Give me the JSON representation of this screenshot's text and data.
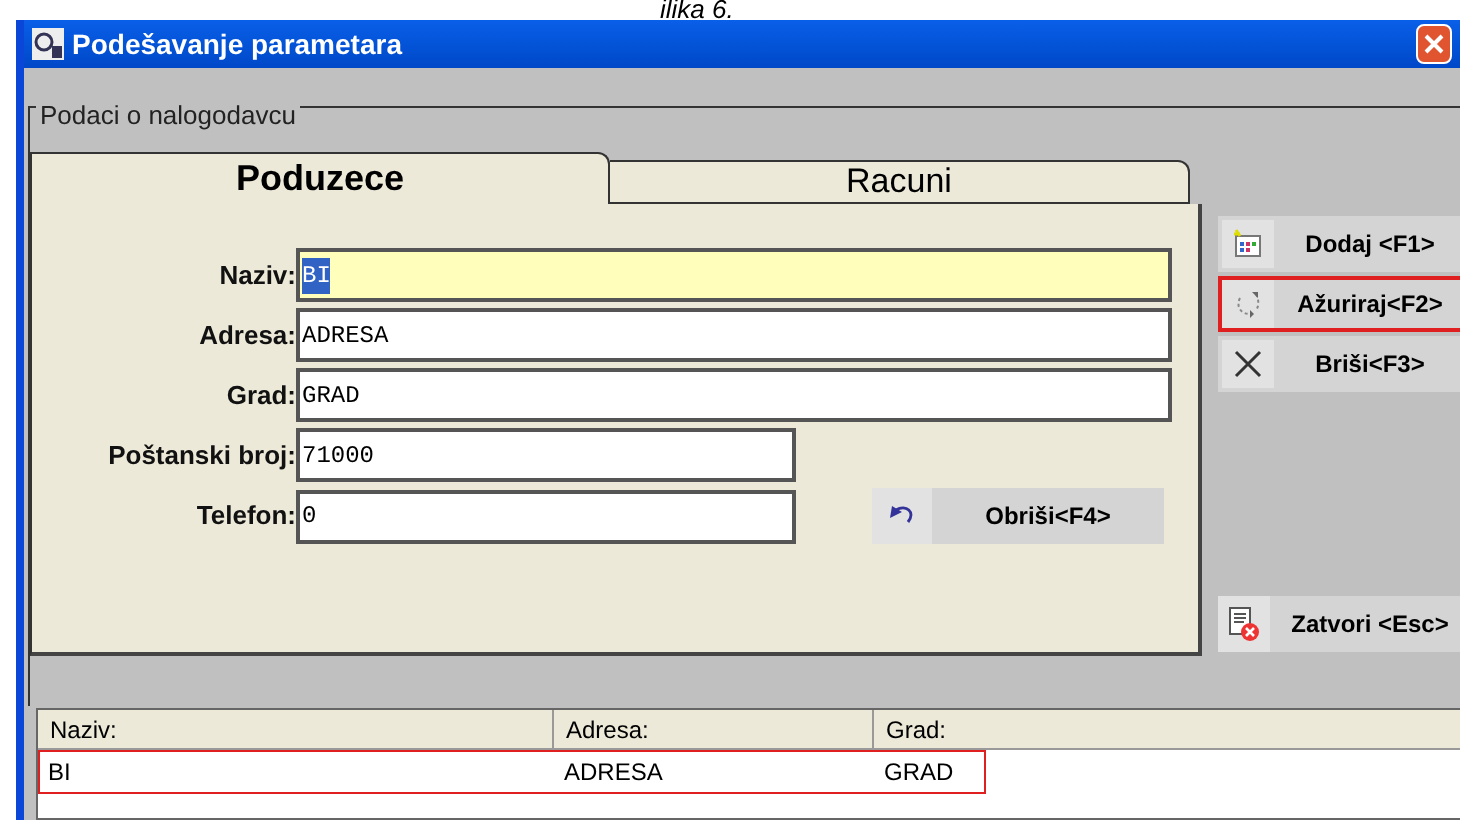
{
  "caption": "ilika 6.",
  "window": {
    "title": "Podešavanje parametara"
  },
  "group": {
    "title": "Podaci o nalogodavcu"
  },
  "tabs": [
    {
      "label": "Poduzece",
      "selected": true
    },
    {
      "label": "Racuni",
      "selected": false
    }
  ],
  "fields": [
    {
      "label": "Naziv:",
      "value": "BI",
      "focused": true,
      "wide": true
    },
    {
      "label": "Adresa:",
      "value": "ADRESA",
      "focused": false,
      "wide": true
    },
    {
      "label": "Grad:",
      "value": "GRAD",
      "focused": false,
      "wide": true
    },
    {
      "label": "Poštanski broj:",
      "value": "71000",
      "focused": false,
      "wide": false
    },
    {
      "label": "Telefon:",
      "value": "0",
      "focused": false,
      "wide": false
    }
  ],
  "clear_button": {
    "label": "Obriši<F4>"
  },
  "side_buttons": [
    {
      "kind": "add",
      "label": "Dodaj <F1>",
      "highlighted": false
    },
    {
      "kind": "update",
      "label": "Ažuriraj<F2>",
      "highlighted": true
    },
    {
      "kind": "delete",
      "label": "Briši<F3>",
      "highlighted": false
    }
  ],
  "close_button": {
    "label": "Zatvori <Esc>"
  },
  "table": {
    "columns": [
      "Naziv:",
      "Adresa:",
      "Grad:"
    ],
    "rows": [
      {
        "cells": [
          "BI",
          "ADRESA",
          "GRAD"
        ],
        "highlighted": true
      }
    ]
  }
}
